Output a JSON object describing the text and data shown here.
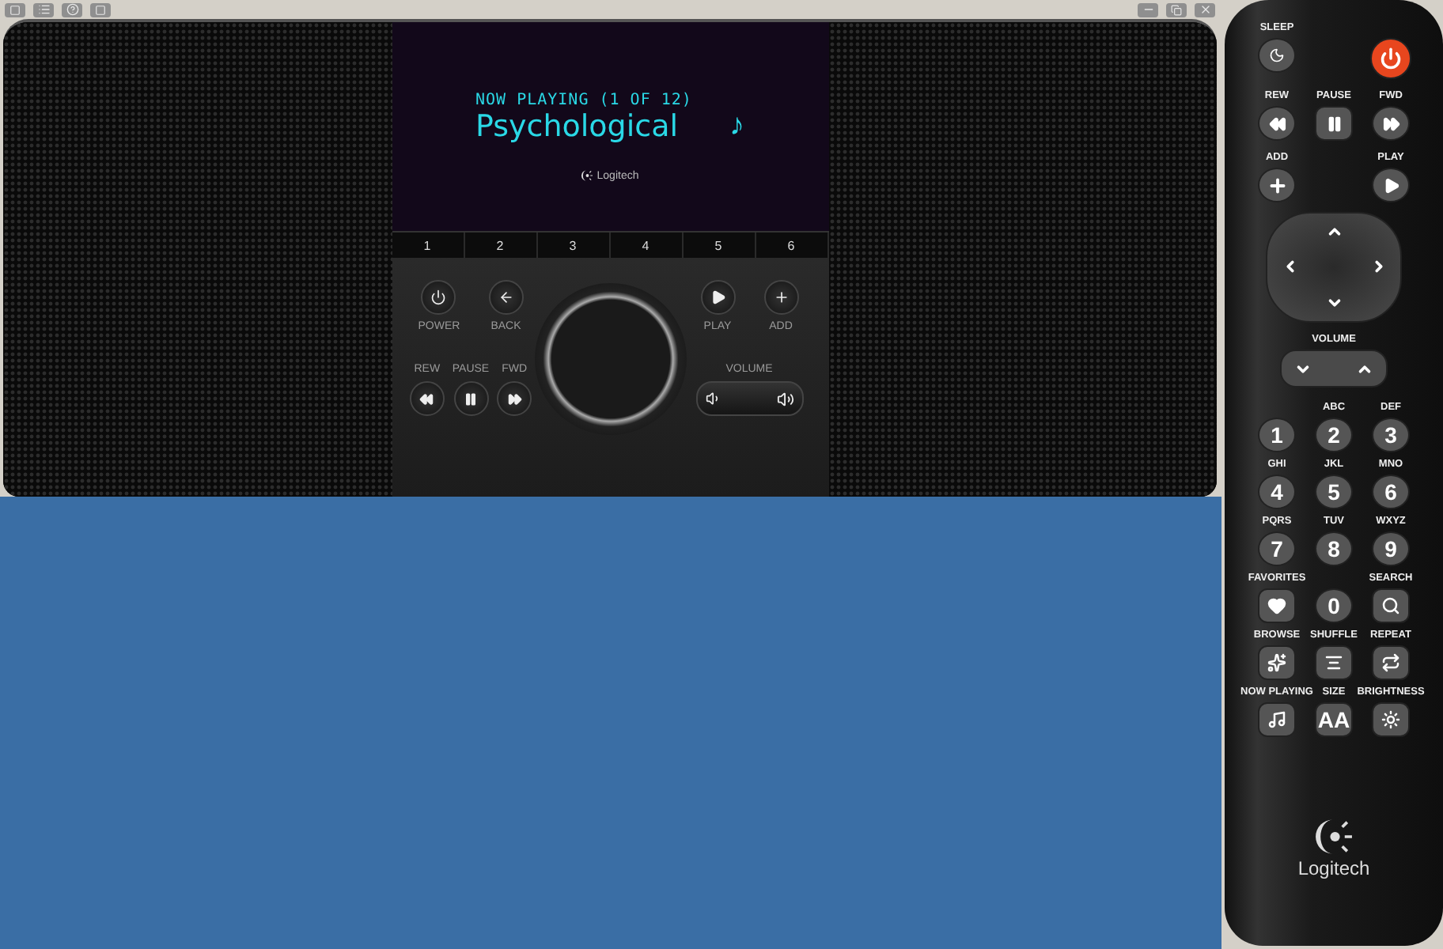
{
  "display": {
    "header": "NOW PLAYING (1 OF 12)",
    "title": "Psychological",
    "note": "♪",
    "brand": "Logitech"
  },
  "presets": [
    "1",
    "2",
    "3",
    "4",
    "5",
    "6"
  ],
  "device": {
    "top_left": [
      {
        "label": "POWER"
      },
      {
        "label": "BACK"
      }
    ],
    "top_right": [
      {
        "label": "PLAY"
      },
      {
        "label": "ADD"
      }
    ],
    "transport": [
      {
        "label": "REW"
      },
      {
        "label": "PAUSE"
      },
      {
        "label": "FWD"
      }
    ],
    "volume": {
      "label": "VOLUME"
    }
  },
  "remote": {
    "sleep": {
      "label": "SLEEP"
    },
    "transport": [
      {
        "label": "REW"
      },
      {
        "label": "PAUSE"
      },
      {
        "label": "FWD"
      }
    ],
    "add": {
      "label": "ADD"
    },
    "play": {
      "label": "PLAY"
    },
    "volume": {
      "label": "VOLUME"
    },
    "keypad": [
      [
        {
          "kind": "digit",
          "glyph": "1"
        },
        {
          "kind": "digit",
          "label": "ABC",
          "glyph": "2"
        },
        {
          "kind": "digit",
          "label": "DEF",
          "glyph": "3"
        }
      ],
      [
        {
          "kind": "digit",
          "label": "GHI",
          "glyph": "4"
        },
        {
          "kind": "digit",
          "label": "JKL",
          "glyph": "5"
        },
        {
          "kind": "digit",
          "label": "MNO",
          "glyph": "6"
        }
      ],
      [
        {
          "kind": "digit",
          "label": "PQRS",
          "glyph": "7"
        },
        {
          "kind": "digit",
          "label": "TUV",
          "glyph": "8"
        },
        {
          "kind": "digit",
          "label": "WXYZ",
          "glyph": "9"
        }
      ],
      [
        {
          "kind": "heart",
          "label": "FAVORITES"
        },
        {
          "kind": "digit",
          "glyph": "0"
        },
        {
          "kind": "search",
          "label": "SEARCH"
        }
      ],
      [
        {
          "kind": "browse",
          "label": "BROWSE"
        },
        {
          "kind": "shuffle",
          "label": "SHUFFLE"
        },
        {
          "kind": "repeat",
          "label": "REPEAT"
        }
      ],
      [
        {
          "kind": "note",
          "label": "NOW PLAYING"
        },
        {
          "kind": "text",
          "label": "SIZE",
          "glyph": "AA"
        },
        {
          "kind": "sun",
          "label": "BRIGHTNESS"
        }
      ]
    ],
    "brand": "Logitech"
  }
}
